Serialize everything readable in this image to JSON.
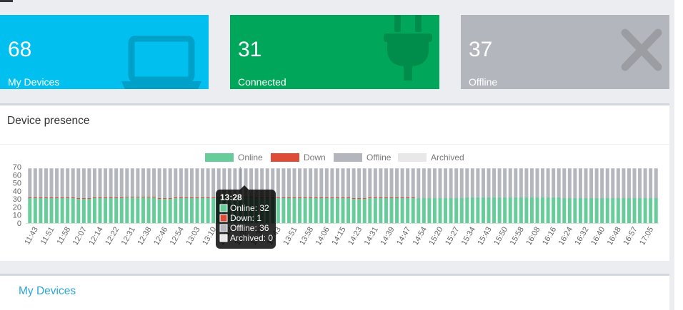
{
  "cards": [
    {
      "id": "devices",
      "number": "68",
      "label": "My Devices",
      "icon": "laptop-icon",
      "color": "#01c0ef"
    },
    {
      "id": "connected",
      "number": "31",
      "label": "Connected",
      "icon": "plug-icon",
      "color": "#00a65a"
    },
    {
      "id": "offline",
      "number": "37",
      "label": "Offline",
      "icon": "close-x-icon",
      "color": "#b4b6bd"
    }
  ],
  "presence": {
    "title": "Device presence"
  },
  "mydevices": {
    "title": "My Devices"
  },
  "chart_data": {
    "type": "bar",
    "stacked": true,
    "legend_position": "top-center",
    "ylim": [
      0,
      70
    ],
    "yticks": [
      "0",
      "10",
      "20",
      "30",
      "40",
      "50",
      "60",
      "70"
    ],
    "tick_labels": [
      "11:43",
      "11:51",
      "11:58",
      "12:07",
      "12:14",
      "12:22",
      "12:31",
      "12:38",
      "12:46",
      "12:54",
      "13:03",
      "13:10",
      "13:19",
      "13:28",
      "13:35",
      "13:43",
      "13:51",
      "13:58",
      "14:06",
      "14:15",
      "14:23",
      "14:31",
      "14:39",
      "14:47",
      "14:54",
      "15:20",
      "15:27",
      "15:34",
      "15:43",
      "15:50",
      "15:58",
      "16:08",
      "16:16",
      "16:24",
      "16:32",
      "16:40",
      "16:48",
      "16:57",
      "17:05"
    ],
    "series": [
      {
        "name": "Online",
        "color": "#66cc99",
        "values": [
          31,
          31,
          31,
          30,
          31,
          31,
          32,
          32,
          30,
          31,
          31,
          31,
          32,
          32,
          31,
          31,
          31,
          31,
          31,
          31,
          30,
          31,
          31,
          31,
          31,
          31,
          31,
          32,
          32,
          32,
          32,
          32,
          32,
          31,
          31,
          31,
          31,
          31,
          31
        ]
      },
      {
        "name": "Down",
        "color": "#dd4b39",
        "values": [
          1,
          1,
          1,
          1,
          1,
          1,
          1,
          1,
          1,
          1,
          1,
          1,
          1,
          1,
          1,
          1,
          1,
          1,
          1,
          1,
          1,
          1,
          1,
          1,
          0,
          0,
          0,
          0,
          0,
          0,
          0,
          0,
          0,
          0,
          0,
          0,
          0,
          0,
          0
        ]
      },
      {
        "name": "Offline",
        "color": "#b4b6bd",
        "values": [
          36,
          36,
          36,
          37,
          36,
          36,
          35,
          35,
          37,
          36,
          36,
          36,
          35,
          35,
          36,
          36,
          36,
          36,
          36,
          36,
          37,
          36,
          36,
          36,
          37,
          37,
          37,
          36,
          36,
          36,
          36,
          36,
          36,
          37,
          37,
          37,
          37,
          37,
          37
        ]
      },
      {
        "name": "Archived",
        "color": "#e8e8e8",
        "values": [
          0,
          0,
          0,
          0,
          0,
          0,
          0,
          0,
          0,
          0,
          0,
          0,
          0,
          0,
          0,
          0,
          0,
          0,
          0,
          0,
          0,
          0,
          0,
          0,
          0,
          0,
          0,
          0,
          0,
          0,
          0,
          0,
          0,
          0,
          0,
          0,
          0,
          0,
          0
        ]
      }
    ],
    "tooltip": {
      "title": "13:28",
      "rows": [
        "Online: 32",
        "Down: 1",
        "Offline: 36",
        "Archived: 0"
      ]
    }
  }
}
